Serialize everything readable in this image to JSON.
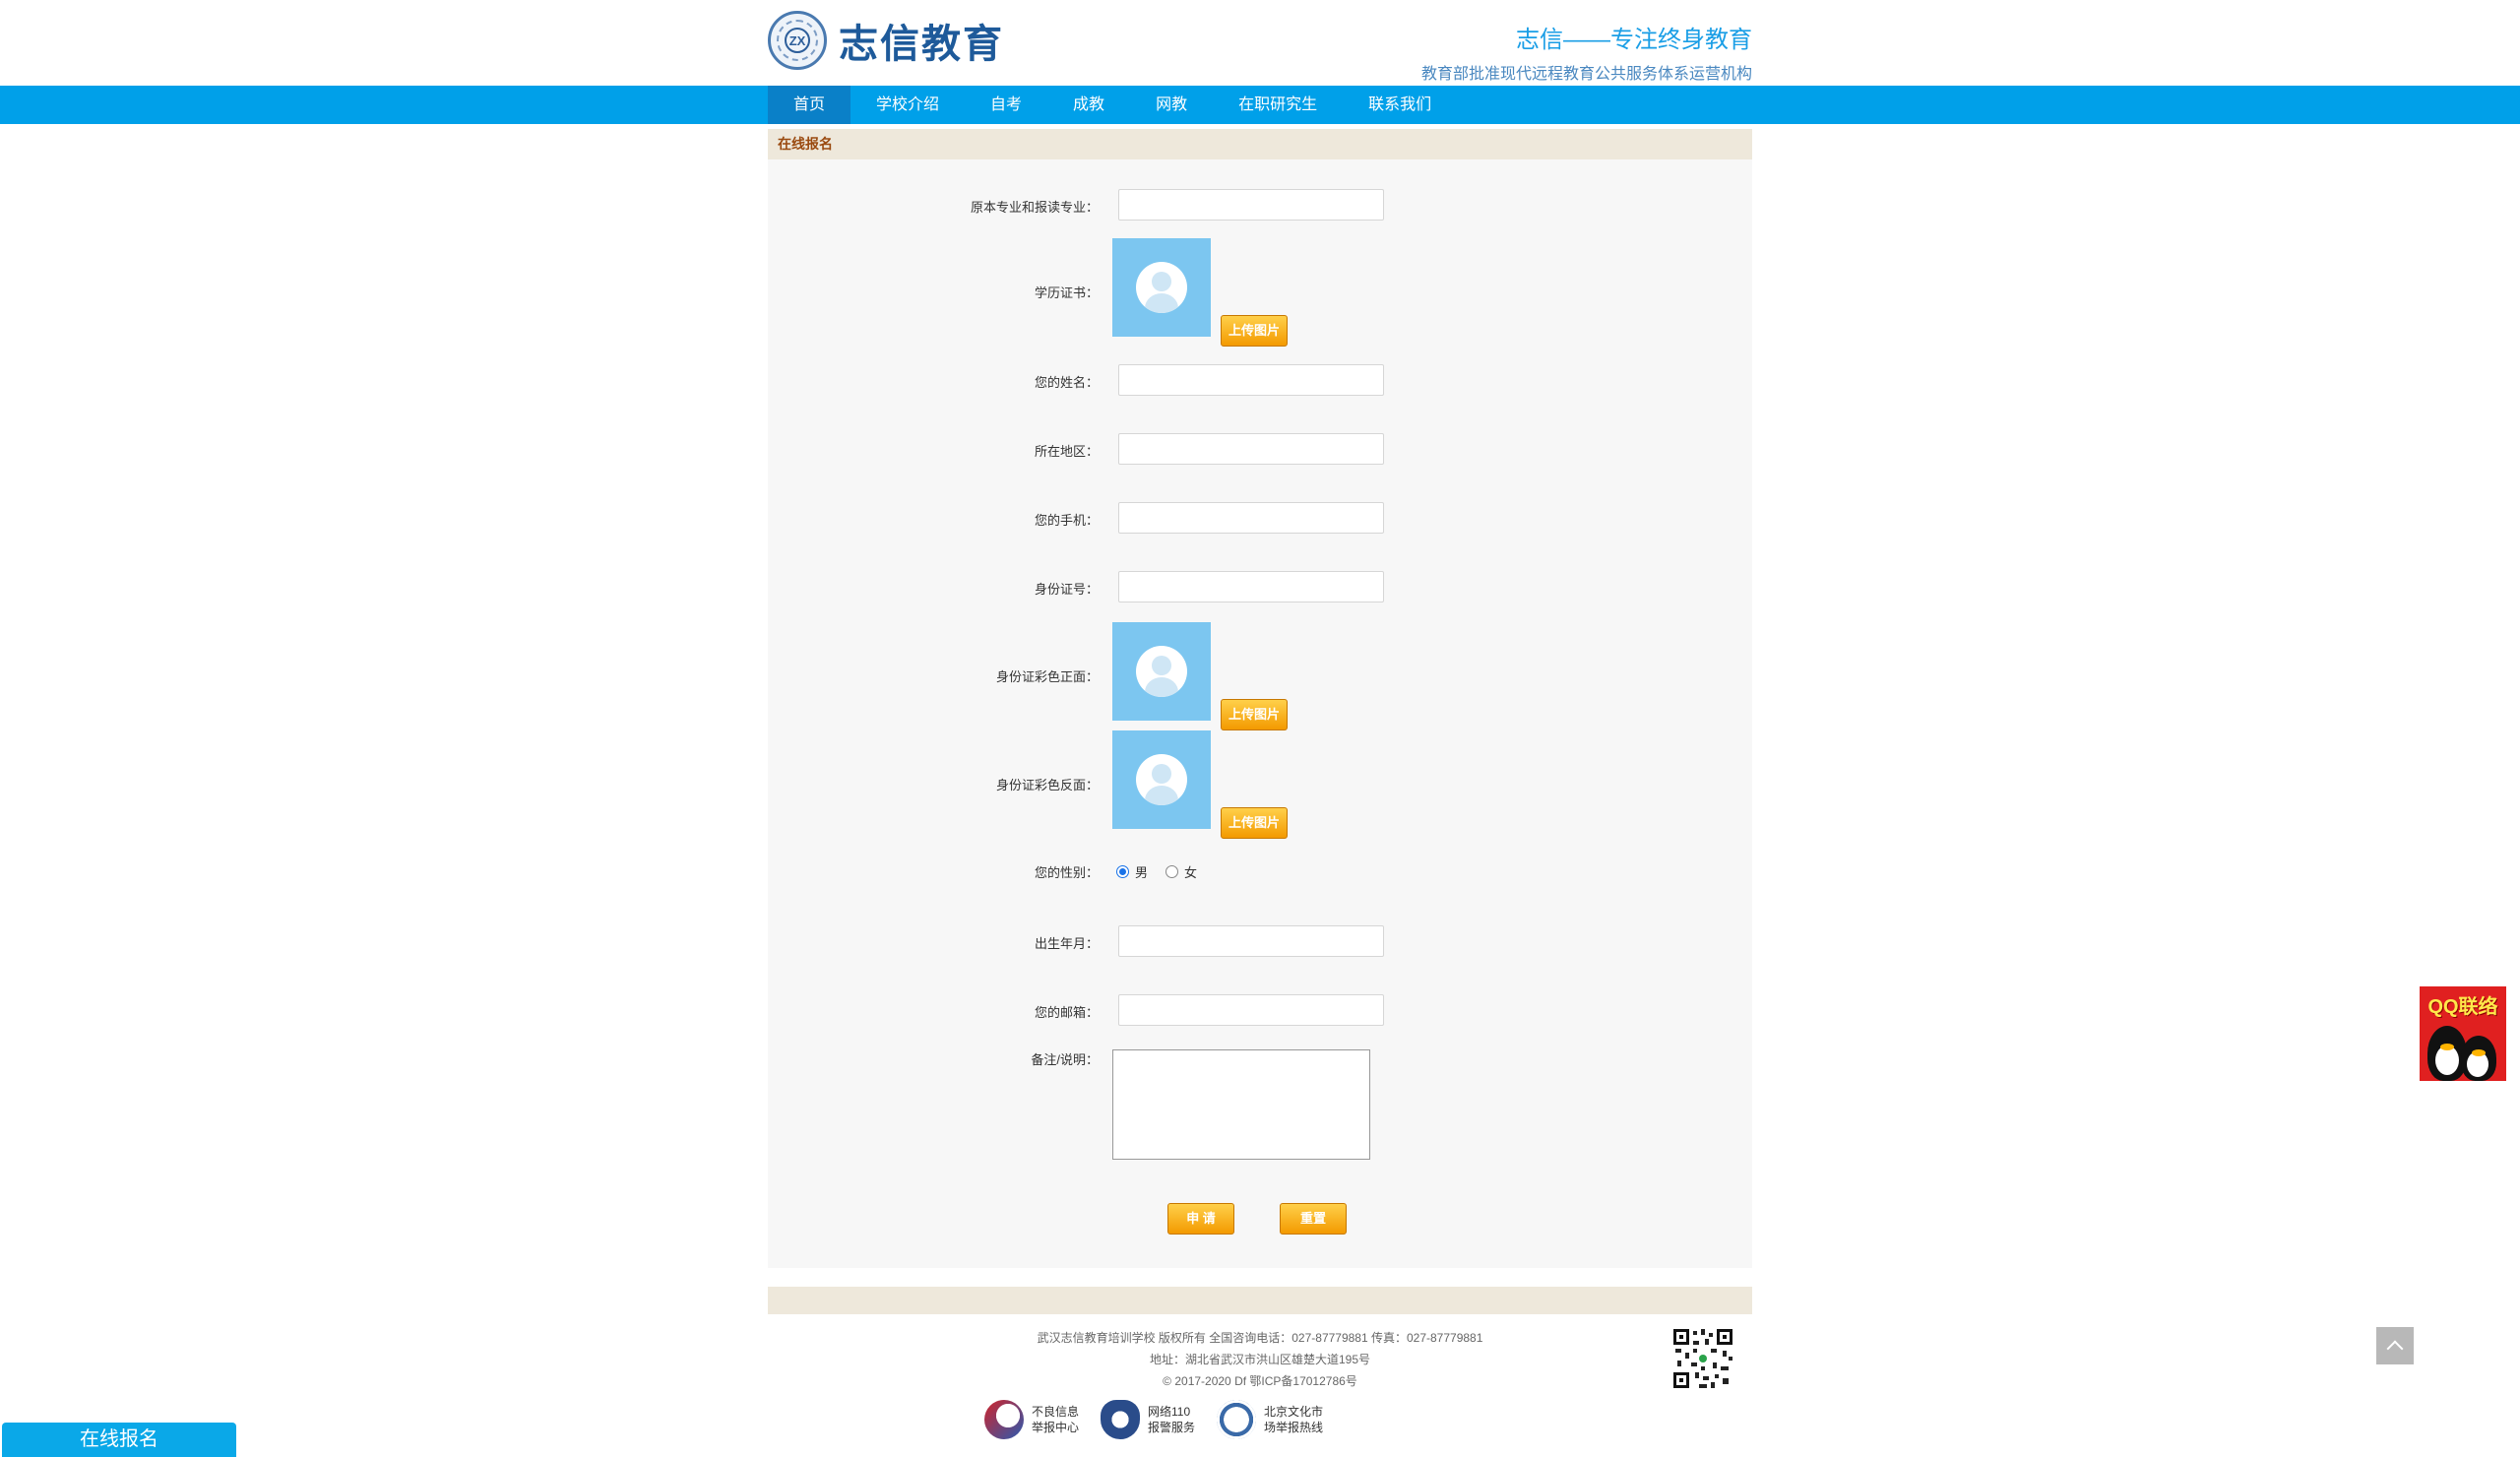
{
  "header": {
    "logo_text": "志信教育",
    "logo_mark": "ZX",
    "slogan_main": "志信——专注终身教育",
    "slogan_sub": "教育部批准现代远程教育公共服务体系运营机构"
  },
  "nav": {
    "items": [
      {
        "label": "首页",
        "active": true
      },
      {
        "label": "学校介绍"
      },
      {
        "label": "自考"
      },
      {
        "label": "成教"
      },
      {
        "label": "网教"
      },
      {
        "label": "在职研究生"
      },
      {
        "label": "联系我们"
      }
    ]
  },
  "section_title": "在线报名",
  "form": {
    "major_label": "原本专业和报读专业：",
    "diploma_label": "学历证书：",
    "upload_label": "上传图片",
    "name_label": "您的姓名：",
    "region_label": "所在地区：",
    "phone_label": "您的手机：",
    "id_label": "身份证号：",
    "id_front_label": "身份证彩色正面：",
    "id_back_label": "身份证彩色反面：",
    "gender_label": "您的性别：",
    "gender_options": [
      "男",
      "女"
    ],
    "gender_selected": "男",
    "birth_label": "出生年月：",
    "email_label": "您的邮箱：",
    "remark_label": "备注/说明：",
    "submit_label": "申 请",
    "reset_label": "重置"
  },
  "footer": {
    "line1": "武汉志信教育培训学校 版权所有 全国咨询电话：027-87779881 传真：027-87779881",
    "line2": "地址：湖北省武汉市洪山区雄楚大道195号",
    "line3": "© 2017-2020 Df 鄂ICP备17012786号",
    "badges": [
      {
        "line1": "不良信息",
        "line2": "举报中心",
        "icon": "report-center-icon",
        "color": "#d0242b"
      },
      {
        "line1": "网络110",
        "line2": "报警服务",
        "icon": "police-110-icon",
        "color": "#2a4c8a"
      },
      {
        "line1": "北京文化市",
        "line2": "场举报热线",
        "icon": "culture-market-icon",
        "color": "#3a6aa8"
      }
    ]
  },
  "floaters": {
    "qq_label": "QQ联络",
    "signup_label": "在线报名"
  },
  "colors": {
    "nav_bg": "#00a0e9",
    "nav_active": "#0a80c8",
    "section_bar": "#eee8db",
    "button_orange": "#f39a00"
  }
}
